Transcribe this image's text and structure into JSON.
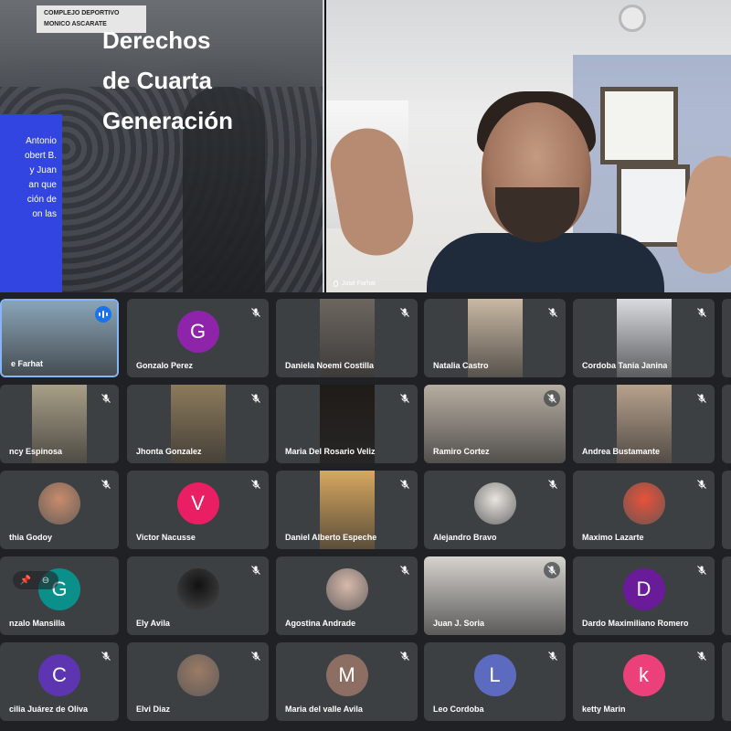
{
  "presentation": {
    "slide_title_lines": [
      "Derechos",
      "de Cuarta",
      "Generación"
    ],
    "sign_lines": [
      "COMPLEJO DEPORTIVO",
      "MONICO ASCARATE"
    ],
    "blue_box_lines": [
      "Antonio",
      "obert B.",
      "y Juan",
      "an que",
      "ción de",
      "on las"
    ],
    "presenter_name": "José Farhat"
  },
  "participants": [
    {
      "name": "e Farhat",
      "kind": "video",
      "bg": "#8aa5b8",
      "state": "speaking"
    },
    {
      "name": "Gonzalo Perez",
      "kind": "avatar",
      "letter": "G",
      "color": "#8e24aa",
      "state": "muted"
    },
    {
      "name": "Daniela Noemi Costilla",
      "kind": "video",
      "bg": "#6d6660",
      "state": "muted"
    },
    {
      "name": "Natalia Castro",
      "kind": "video",
      "bg": "#c9b8a4",
      "state": "muted"
    },
    {
      "name": "Cordoba Tania Janina",
      "kind": "video",
      "bg": "#d9dbe0",
      "state": "muted"
    },
    {
      "name": "ncy Espinosa",
      "kind": "video",
      "bg": "#a89f87",
      "state": "muted"
    },
    {
      "name": "Jhonta Gonzalez",
      "kind": "video",
      "bg": "#8c7a5c",
      "state": "muted"
    },
    {
      "name": "Maria Del Rosario Veliz",
      "kind": "video",
      "bg": "#1f1b18",
      "state": "muted"
    },
    {
      "name": "Ramiro Cortez",
      "kind": "video",
      "bg": "#b7aea2",
      "state": "muted-circle"
    },
    {
      "name": "Andrea Bustamante",
      "kind": "video",
      "bg": "#b7a18c",
      "state": "muted"
    },
    {
      "name": "thia Godoy",
      "kind": "photo",
      "bg": "#c98c6c",
      "state": "muted"
    },
    {
      "name": "Victor Nacusse",
      "kind": "avatar",
      "letter": "V",
      "color": "#e91e63",
      "state": "muted"
    },
    {
      "name": "Daniel Alberto Espeche",
      "kind": "video",
      "bg": "#d7a860",
      "state": "muted"
    },
    {
      "name": "Alejandro Bravo",
      "kind": "photo",
      "bg": "#e8e4de",
      "state": "muted"
    },
    {
      "name": "Maximo Lazarte",
      "kind": "photo",
      "bg": "#e8523a",
      "state": "muted"
    },
    {
      "name": "nzalo Mansilla",
      "kind": "avatar",
      "letter": "G",
      "color": "#0b8f8a",
      "state": "hover"
    },
    {
      "name": "Ely Avila",
      "kind": "photo",
      "bg": "#111111",
      "state": "muted"
    },
    {
      "name": "Agostina Andrade",
      "kind": "photo",
      "bg": "#d8b9ab",
      "state": "muted"
    },
    {
      "name": "Juan J. Soria",
      "kind": "video",
      "bg": "#d6d3ce",
      "state": "muted-circle"
    },
    {
      "name": "Dardo Maximiliano Romero",
      "kind": "avatar",
      "letter": "D",
      "color": "#6a1b9a",
      "state": "muted"
    },
    {
      "name": "cilia Juárez de Oliva",
      "kind": "avatar",
      "letter": "C",
      "color": "#5e35b1",
      "state": "muted"
    },
    {
      "name": "Elvi Diaz",
      "kind": "photo",
      "bg": "#9c7b66",
      "state": "muted"
    },
    {
      "name": "Maria del valle Avila",
      "kind": "avatar",
      "letter": "M",
      "color": "#8d6e63",
      "state": "muted"
    },
    {
      "name": "Leo Cordoba",
      "kind": "avatar",
      "letter": "L",
      "color": "#5c6bc0",
      "state": "muted"
    },
    {
      "name": "ketty Marin",
      "kind": "avatar",
      "letter": "k",
      "color": "#ec407a",
      "state": "muted"
    }
  ]
}
